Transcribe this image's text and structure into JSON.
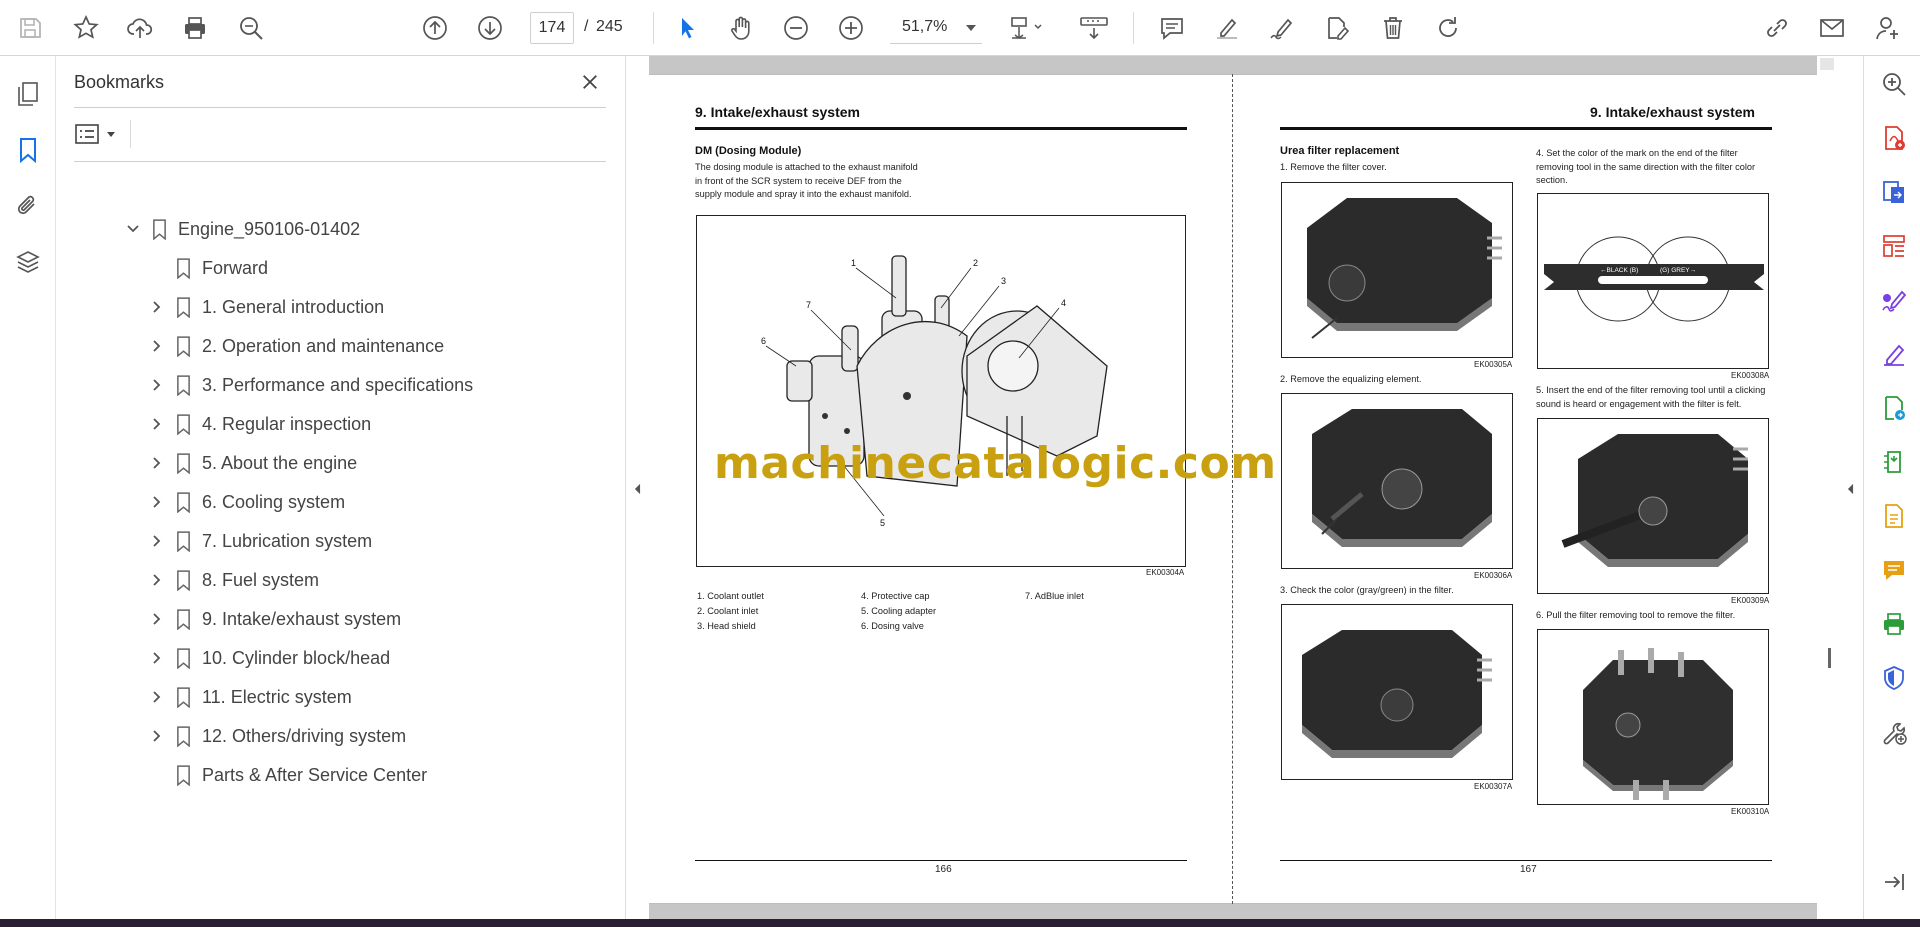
{
  "toolbar": {
    "icons": [
      "save-icon",
      "bookmark-star-icon",
      "upload-icon",
      "print-icon",
      "search-zoom-icon",
      "page-up-icon",
      "page-down-icon",
      "select-cursor-icon",
      "hand-icon",
      "zoom-out-icon",
      "zoom-in-icon",
      "fit-page-icon",
      "scroll-mode-icon",
      "comment-icon",
      "highlight-icon",
      "sign-icon",
      "edit-doc-icon",
      "delete-icon",
      "redo-icon",
      "share-link-icon",
      "email-icon",
      "account-icon"
    ],
    "current_page": "174",
    "page_sep": "/",
    "total_pages": "245",
    "zoom": "51,7%"
  },
  "left_strip": {
    "icons": [
      "pages-icon",
      "bookmarks-icon",
      "attachments-icon",
      "layers-icon"
    ]
  },
  "bookmarks": {
    "title": "Bookmarks",
    "items": [
      {
        "label": "Engine_950106-01402",
        "level": 0,
        "expander": "expanded"
      },
      {
        "label": "Forward",
        "level": 1,
        "expander": "none"
      },
      {
        "label": "1. General introduction",
        "level": 1,
        "expander": "collapsed"
      },
      {
        "label": "2. Operation and maintenance",
        "level": 1,
        "expander": "collapsed"
      },
      {
        "label": "3. Performance and specifications",
        "level": 1,
        "expander": "collapsed"
      },
      {
        "label": "4. Regular inspection",
        "level": 1,
        "expander": "collapsed"
      },
      {
        "label": "5. About the engine",
        "level": 1,
        "expander": "collapsed"
      },
      {
        "label": "6. Cooling system",
        "level": 1,
        "expander": "collapsed"
      },
      {
        "label": "7. Lubrication system",
        "level": 1,
        "expander": "collapsed"
      },
      {
        "label": "8. Fuel system",
        "level": 1,
        "expander": "collapsed"
      },
      {
        "label": "9. Intake/exhaust system",
        "level": 1,
        "expander": "collapsed"
      },
      {
        "label": "10. Cylinder block/head",
        "level": 1,
        "expander": "collapsed"
      },
      {
        "label": "11. Electric system",
        "level": 1,
        "expander": "collapsed"
      },
      {
        "label": "12. Others/driving system",
        "level": 1,
        "expander": "collapsed"
      },
      {
        "label": "Parts & After Service Center",
        "level": 1,
        "expander": "none"
      }
    ]
  },
  "document": {
    "left_page": {
      "header": "9.  Intake/exhaust system",
      "subhead": "DM (Dosing Module)",
      "body": [
        "The dosing module is attached to the exhaust manifold",
        "in front of the SCR system to receive DEF from the",
        "supply module and spray it into the exhaust manifold."
      ],
      "figure_code": "EK00304A",
      "callouts": [
        "1",
        "2",
        "3",
        "4",
        "5",
        "6",
        "7"
      ],
      "legend": [
        [
          "1. Coolant outlet",
          "2. Coolant inlet",
          "3. Head shield"
        ],
        [
          "4. Protective cap",
          "5. Cooling adapter",
          "6. Dosing valve"
        ],
        [
          "7. AdBlue inlet"
        ]
      ],
      "page_number": "166"
    },
    "right_page": {
      "header": "9.  Intake/exhaust system",
      "subhead": "Urea filter replacement",
      "steps_left": [
        {
          "text": "1.  Remove the filter cover.",
          "code": "EK00305A"
        },
        {
          "text": "2.  Remove the equalizing element.",
          "code": "EK00306A"
        },
        {
          "text": "3.  Check the color (gray/green) in the filter.",
          "code": "EK00307A"
        }
      ],
      "steps_right": [
        {
          "text": [
            "4.  Set the color of the mark on the end of the filter",
            "     removing tool in the same direction with the filter color",
            "     section."
          ],
          "code": "EK00308A"
        },
        {
          "text": [
            "5.  Insert the end of the filter removing tool until a clicking",
            "     sound is heard or engagement with the filter is felt."
          ],
          "code": "EK00309A"
        },
        {
          "text": [
            "6.  Pull the filter removing tool to remove the filter."
          ],
          "code": "EK00310A"
        }
      ],
      "tool_labels": [
        "←BLACK (B)",
        "(G) GREY→"
      ],
      "page_number": "167"
    },
    "watermark": "machinecatalogic.com"
  },
  "right_strip": {
    "icons": [
      "zoom-search-icon",
      "export-pdf-icon",
      "create-pdf-icon",
      "organize-pages-icon",
      "fill-sign-icon",
      "edit-pdf-icon",
      "convert-icon",
      "compress-icon",
      "scan-icon",
      "comment-tool-icon",
      "print-production-icon",
      "protect-icon",
      "more-tools-icon",
      "expand-panel-icon"
    ]
  },
  "colors": {
    "accent": "#1473e6",
    "watermark": "#c8a010",
    "tool_red": "#e03c31",
    "tool_purple": "#7b3fe4",
    "tool_green": "#2d9d3a"
  }
}
